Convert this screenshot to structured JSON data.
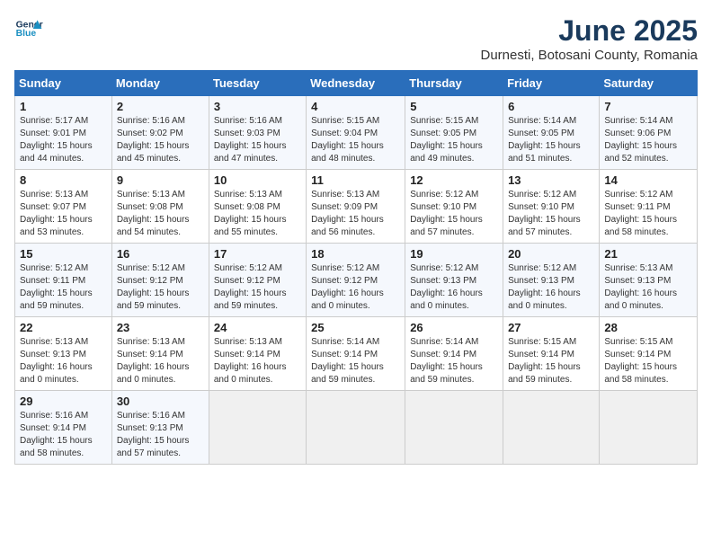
{
  "header": {
    "logo_line1": "General",
    "logo_line2": "Blue",
    "title": "June 2025",
    "subtitle": "Durnesti, Botosani County, Romania"
  },
  "calendar": {
    "days_of_week": [
      "Sunday",
      "Monday",
      "Tuesday",
      "Wednesday",
      "Thursday",
      "Friday",
      "Saturday"
    ],
    "weeks": [
      [
        null,
        null,
        null,
        null,
        null,
        null,
        null
      ]
    ]
  },
  "cells": {
    "w1": [
      null,
      null,
      null,
      null,
      null,
      null,
      null
    ]
  },
  "days": [
    {
      "num": "1",
      "col": 0,
      "week": 0,
      "sunrise": "5:17 AM",
      "sunset": "9:01 PM",
      "daylight": "15 hours and 44 minutes."
    },
    {
      "num": "2",
      "col": 1,
      "week": 0,
      "sunrise": "5:16 AM",
      "sunset": "9:02 PM",
      "daylight": "15 hours and 45 minutes."
    },
    {
      "num": "3",
      "col": 2,
      "week": 0,
      "sunrise": "5:16 AM",
      "sunset": "9:03 PM",
      "daylight": "15 hours and 47 minutes."
    },
    {
      "num": "4",
      "col": 3,
      "week": 0,
      "sunrise": "5:15 AM",
      "sunset": "9:04 PM",
      "daylight": "15 hours and 48 minutes."
    },
    {
      "num": "5",
      "col": 4,
      "week": 0,
      "sunrise": "5:15 AM",
      "sunset": "9:05 PM",
      "daylight": "15 hours and 49 minutes."
    },
    {
      "num": "6",
      "col": 5,
      "week": 0,
      "sunrise": "5:14 AM",
      "sunset": "9:05 PM",
      "daylight": "15 hours and 51 minutes."
    },
    {
      "num": "7",
      "col": 6,
      "week": 0,
      "sunrise": "5:14 AM",
      "sunset": "9:06 PM",
      "daylight": "15 hours and 52 minutes."
    },
    {
      "num": "8",
      "col": 0,
      "week": 1,
      "sunrise": "5:13 AM",
      "sunset": "9:07 PM",
      "daylight": "15 hours and 53 minutes."
    },
    {
      "num": "9",
      "col": 1,
      "week": 1,
      "sunrise": "5:13 AM",
      "sunset": "9:08 PM",
      "daylight": "15 hours and 54 minutes."
    },
    {
      "num": "10",
      "col": 2,
      "week": 1,
      "sunrise": "5:13 AM",
      "sunset": "9:08 PM",
      "daylight": "15 hours and 55 minutes."
    },
    {
      "num": "11",
      "col": 3,
      "week": 1,
      "sunrise": "5:13 AM",
      "sunset": "9:09 PM",
      "daylight": "15 hours and 56 minutes."
    },
    {
      "num": "12",
      "col": 4,
      "week": 1,
      "sunrise": "5:12 AM",
      "sunset": "9:10 PM",
      "daylight": "15 hours and 57 minutes."
    },
    {
      "num": "13",
      "col": 5,
      "week": 1,
      "sunrise": "5:12 AM",
      "sunset": "9:10 PM",
      "daylight": "15 hours and 57 minutes."
    },
    {
      "num": "14",
      "col": 6,
      "week": 1,
      "sunrise": "5:12 AM",
      "sunset": "9:11 PM",
      "daylight": "15 hours and 58 minutes."
    },
    {
      "num": "15",
      "col": 0,
      "week": 2,
      "sunrise": "5:12 AM",
      "sunset": "9:11 PM",
      "daylight": "15 hours and 59 minutes."
    },
    {
      "num": "16",
      "col": 1,
      "week": 2,
      "sunrise": "5:12 AM",
      "sunset": "9:12 PM",
      "daylight": "15 hours and 59 minutes."
    },
    {
      "num": "17",
      "col": 2,
      "week": 2,
      "sunrise": "5:12 AM",
      "sunset": "9:12 PM",
      "daylight": "15 hours and 59 minutes."
    },
    {
      "num": "18",
      "col": 3,
      "week": 2,
      "sunrise": "5:12 AM",
      "sunset": "9:12 PM",
      "daylight": "16 hours and 0 minutes."
    },
    {
      "num": "19",
      "col": 4,
      "week": 2,
      "sunrise": "5:12 AM",
      "sunset": "9:13 PM",
      "daylight": "16 hours and 0 minutes."
    },
    {
      "num": "20",
      "col": 5,
      "week": 2,
      "sunrise": "5:12 AM",
      "sunset": "9:13 PM",
      "daylight": "16 hours and 0 minutes."
    },
    {
      "num": "21",
      "col": 6,
      "week": 2,
      "sunrise": "5:13 AM",
      "sunset": "9:13 PM",
      "daylight": "16 hours and 0 minutes."
    },
    {
      "num": "22",
      "col": 0,
      "week": 3,
      "sunrise": "5:13 AM",
      "sunset": "9:13 PM",
      "daylight": "16 hours and 0 minutes."
    },
    {
      "num": "23",
      "col": 1,
      "week": 3,
      "sunrise": "5:13 AM",
      "sunset": "9:14 PM",
      "daylight": "16 hours and 0 minutes."
    },
    {
      "num": "24",
      "col": 2,
      "week": 3,
      "sunrise": "5:13 AM",
      "sunset": "9:14 PM",
      "daylight": "16 hours and 0 minutes."
    },
    {
      "num": "25",
      "col": 3,
      "week": 3,
      "sunrise": "5:14 AM",
      "sunset": "9:14 PM",
      "daylight": "15 hours and 59 minutes."
    },
    {
      "num": "26",
      "col": 4,
      "week": 3,
      "sunrise": "5:14 AM",
      "sunset": "9:14 PM",
      "daylight": "15 hours and 59 minutes."
    },
    {
      "num": "27",
      "col": 5,
      "week": 3,
      "sunrise": "5:15 AM",
      "sunset": "9:14 PM",
      "daylight": "15 hours and 59 minutes."
    },
    {
      "num": "28",
      "col": 6,
      "week": 3,
      "sunrise": "5:15 AM",
      "sunset": "9:14 PM",
      "daylight": "15 hours and 58 minutes."
    },
    {
      "num": "29",
      "col": 0,
      "week": 4,
      "sunrise": "5:16 AM",
      "sunset": "9:14 PM",
      "daylight": "15 hours and 58 minutes."
    },
    {
      "num": "30",
      "col": 1,
      "week": 4,
      "sunrise": "5:16 AM",
      "sunset": "9:13 PM",
      "daylight": "15 hours and 57 minutes."
    }
  ]
}
